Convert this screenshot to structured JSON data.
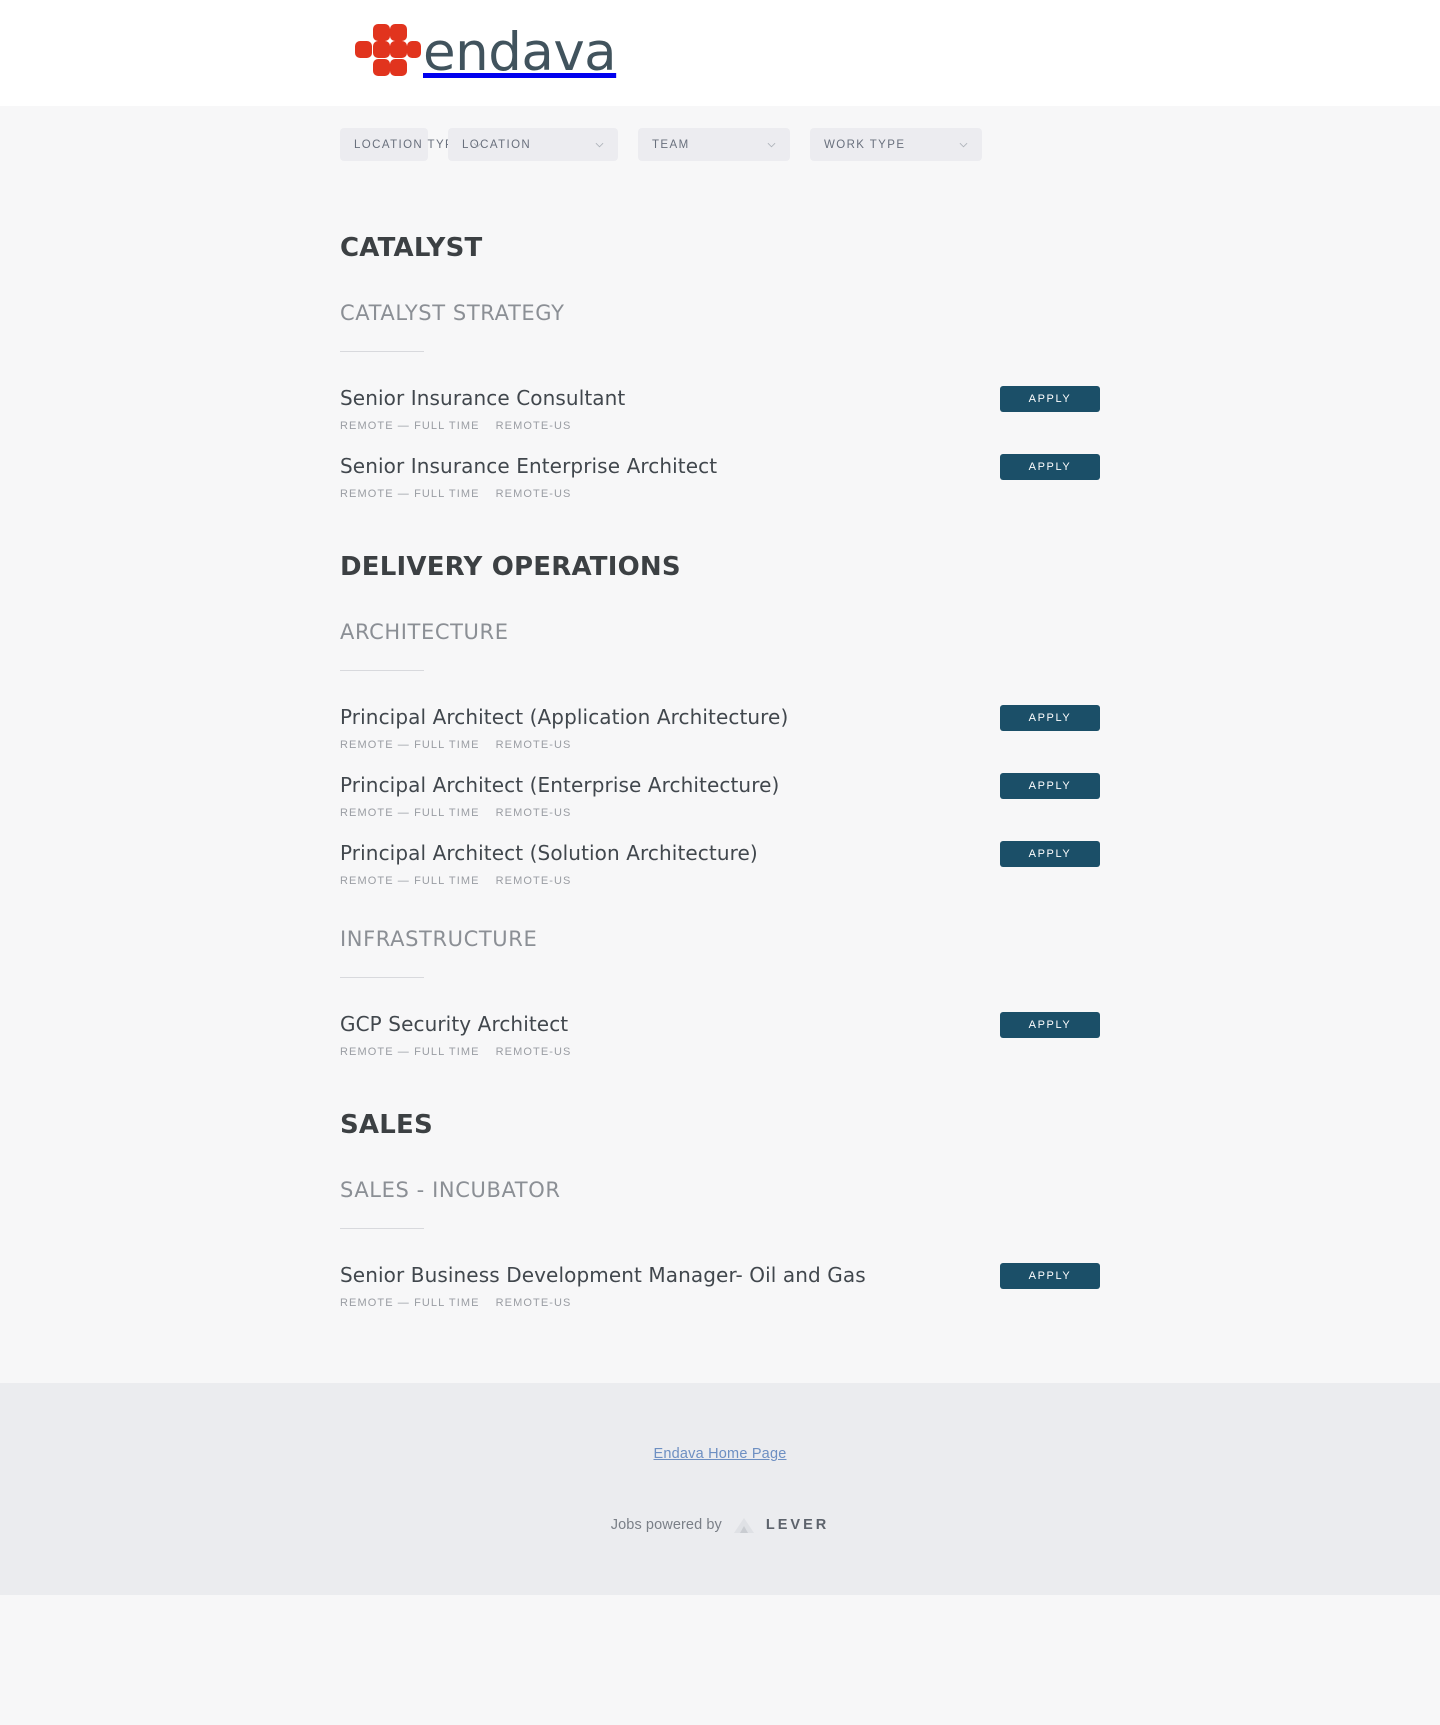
{
  "header": {
    "logo_text": "endava",
    "logo_color": "#e1341e",
    "logo_word_color": "#41535d"
  },
  "filters": [
    {
      "label": "LOCATION TYPE",
      "icon": "chevron-down-icon",
      "name": "location-type"
    },
    {
      "label": "LOCATION",
      "icon": "chevron-down-icon",
      "name": "location"
    },
    {
      "label": "TEAM",
      "icon": "chevron-down-icon",
      "name": "team"
    },
    {
      "label": "WORK TYPE",
      "icon": "chevron-down-icon",
      "name": "work-type"
    }
  ],
  "apply_label": "APPLY",
  "accent_color": "#1b4f68",
  "departments": [
    {
      "name": "CATALYST",
      "teams": [
        {
          "name": "CATALYST STRATEGY",
          "jobs": [
            {
              "title": "Senior Insurance Consultant",
              "commitment": "REMOTE — FULL TIME",
              "location": "REMOTE-US"
            },
            {
              "title": "Senior Insurance Enterprise Architect",
              "commitment": "REMOTE — FULL TIME",
              "location": "REMOTE-US"
            }
          ]
        }
      ]
    },
    {
      "name": "DELIVERY OPERATIONS",
      "teams": [
        {
          "name": "ARCHITECTURE",
          "jobs": [
            {
              "title": "Principal Architect (Application Architecture)",
              "commitment": "REMOTE — FULL TIME",
              "location": "REMOTE-US"
            },
            {
              "title": "Principal Architect (Enterprise Architecture)",
              "commitment": "REMOTE — FULL TIME",
              "location": "REMOTE-US"
            },
            {
              "title": "Principal Architect (Solution Architecture)",
              "commitment": "REMOTE — FULL TIME",
              "location": "REMOTE-US"
            }
          ]
        },
        {
          "name": "INFRASTRUCTURE",
          "jobs": [
            {
              "title": "GCP Security Architect",
              "commitment": "REMOTE — FULL TIME",
              "location": "REMOTE-US"
            }
          ]
        }
      ]
    },
    {
      "name": "SALES",
      "teams": [
        {
          "name": "SALES - INCUBATOR",
          "jobs": [
            {
              "title": "Senior Business Development Manager- Oil and Gas",
              "commitment": "REMOTE — FULL TIME",
              "location": "REMOTE-US"
            }
          ]
        }
      ]
    }
  ],
  "footer": {
    "home_link": "Endava Home Page",
    "powered_by": "Jobs powered by",
    "lever_word": "LEVER",
    "lever_icon": "lever-logo-icon"
  }
}
